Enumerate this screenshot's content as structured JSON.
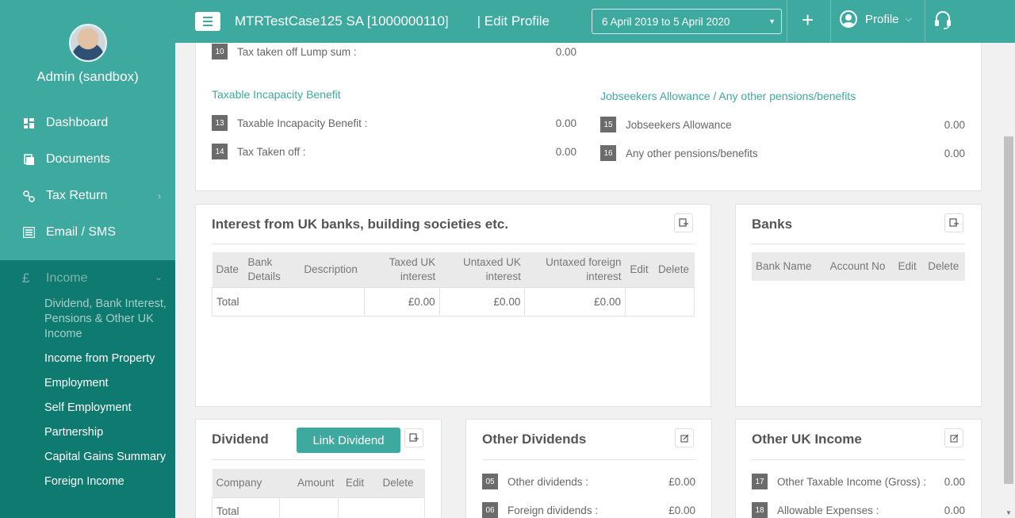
{
  "sidebar": {
    "user_name": "Admin (sandbox)",
    "nav": [
      {
        "label": "Dashboard",
        "icon": "dashboard-icon"
      },
      {
        "label": "Documents",
        "icon": "documents-icon"
      },
      {
        "label": "Tax Return",
        "icon": "tax-return-icon"
      },
      {
        "label": "Email / SMS",
        "icon": "email-icon"
      }
    ],
    "income": {
      "label": "Income",
      "icon": "pound-icon",
      "items": [
        "Dividend, Bank Interest, Pensions & Other UK Income",
        "Income from Property",
        "Employment",
        "Self Employment",
        "Partnership",
        "Capital Gains Summary",
        "Foreign Income"
      ]
    }
  },
  "header": {
    "client": "MTRTestCase125 SA [1000000110]",
    "page": "| Edit Profile",
    "period": "6 April 2019 to 5 April 2020",
    "profile_label": "Profile"
  },
  "benefits": {
    "row10": {
      "num": "10",
      "label": "Tax taken off Lump sum :",
      "value": "0.00"
    },
    "incapacity": {
      "title": "Taxable Incapacity Benefit",
      "rows": [
        {
          "num": "13",
          "label": "Taxable Incapacity Benefit :",
          "value": "0.00"
        },
        {
          "num": "14",
          "label": "Tax Taken off :",
          "value": "0.00"
        }
      ]
    },
    "jobseekers": {
      "title": "Jobseekers Allowance / Any other pensions/benefits",
      "rows": [
        {
          "num": "15",
          "label": "Jobseekers Allowance",
          "value": "0.00"
        },
        {
          "num": "16",
          "label": "Any other pensions/benefits",
          "value": "0.00"
        }
      ]
    }
  },
  "interest": {
    "title": "Interest from UK banks, building societies etc.",
    "columns": [
      "Date",
      "Bank Details",
      "Description",
      "Taxed UK interest",
      "Untaxed UK interest",
      "Untaxed foreign interest",
      "Edit",
      "Delete"
    ],
    "total_label": "Total",
    "totals": [
      "£0.00",
      "£0.00",
      "£0.00"
    ]
  },
  "banks": {
    "title": "Banks",
    "columns": [
      "Bank Name",
      "Account No",
      "Edit",
      "Delete"
    ]
  },
  "dividend": {
    "title": "Dividend",
    "link_label": "Link Dividend",
    "columns": [
      "Company",
      "Amount",
      "Edit",
      "Delete"
    ],
    "total_label": "Total"
  },
  "other_dividends": {
    "title": "Other Dividends",
    "rows": [
      {
        "num": "05",
        "label": "Other dividends :",
        "value": "£0.00"
      },
      {
        "num": "06",
        "label": "Foreign dividends :",
        "value": "£0.00"
      }
    ]
  },
  "other_uk_income": {
    "title": "Other UK Income",
    "rows": [
      {
        "num": "17",
        "label": "Other Taxable Income (Gross) :",
        "value": "0.00"
      },
      {
        "num": "18",
        "label": "Allowable Expenses :",
        "value": "0.00"
      }
    ]
  },
  "colors": {
    "brand": "#3ea99f",
    "sidebar_active": "#0f7a70"
  }
}
